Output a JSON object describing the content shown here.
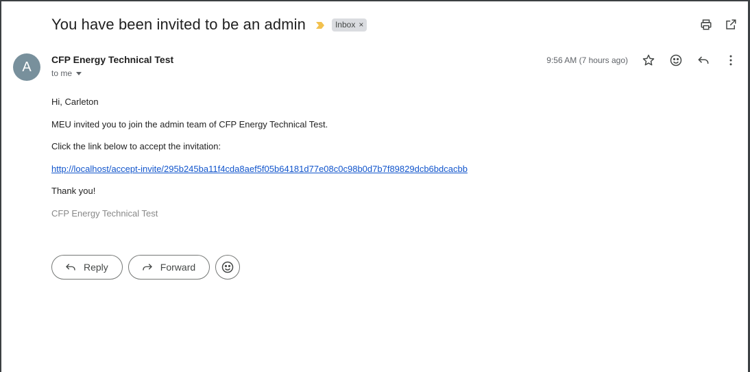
{
  "email": {
    "subject": "You have been invited to be an admin",
    "label": "Inbox",
    "label_remove": "×",
    "sender_initial": "A",
    "sender_name": "CFP Energy Technical Test",
    "recipient": "to me",
    "timestamp": "9:56 AM (7 hours ago)",
    "body": {
      "greeting": "Hi, Carleton",
      "line1": "MEU invited you to join the admin team of CFP Energy Technical Test.",
      "line2": "Click the link below to accept the invitation:",
      "link": "http://localhost/accept-invite/295b245ba11f4cda8aef5f05b64181d77e08c0c98b0d7b7f89829dcb6bdcacbb",
      "thanks": "Thank you!",
      "signature": "CFP Energy Technical Test"
    }
  },
  "actions": {
    "reply_label": "Reply",
    "forward_label": "Forward"
  },
  "colors": {
    "avatar": "#78909c",
    "importance": "#f2c14e",
    "link": "#1155cc"
  }
}
